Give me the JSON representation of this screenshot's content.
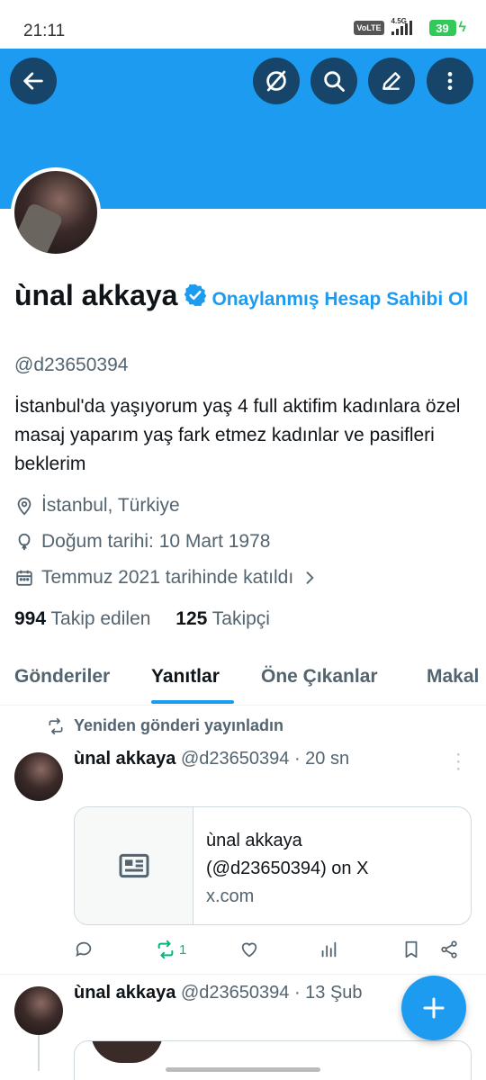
{
  "status_bar": {
    "time": "21:11",
    "network_badge": "VoLTE",
    "network_type": "4.5G",
    "battery_level": "39"
  },
  "header": {
    "back_icon": "arrow-left-icon",
    "actions": [
      "grok-icon",
      "search-icon",
      "edit-icon",
      "more-vertical-icon"
    ],
    "banner_color": "#1d9bf0"
  },
  "profile": {
    "name": "ùnal akkaya",
    "verified_cta": "Onaylanmış Hesap Sahibi Ol",
    "handle": "@d23650394",
    "bio": "İstanbul'da yaşıyorum yaş 4 full aktifim kadınlara özel masaj yaparım yaş fark etmez kadınlar ve pasifleri beklerim",
    "location": "İstanbul, Türkiye",
    "birthday": "Doğum tarihi: 10 Mart 1978",
    "joined": "Temmuz 2021 tarihinde katıldı",
    "following_count": "994",
    "following_label": "Takip edilen",
    "followers_count": "125",
    "followers_label": "Takipçi"
  },
  "tabs": [
    {
      "label": "Gönderiler"
    },
    {
      "label": "Yanıtlar"
    },
    {
      "label": "Öne Çıkanlar"
    },
    {
      "label": "Makal"
    }
  ],
  "active_tab": "Yanıtlar",
  "posts": [
    {
      "repost_context": "Yeniden gönderi yayınladın",
      "author": "ùnal akkaya",
      "handle_time": "@d23650394 · 20 sn",
      "card": {
        "title_line1": "ùnal akkaya",
        "title_line2": "(@d23650394) on X",
        "domain": "x.com"
      },
      "repost_count": "1"
    },
    {
      "author": "ùnal akkaya",
      "handle_time": "@d23650394 · 13 Şub"
    }
  ],
  "fab": {
    "icon": "plus-icon"
  },
  "colors": {
    "accent": "#1d9bf0",
    "repost_active": "#00ba7c",
    "text_secondary": "#536471"
  }
}
